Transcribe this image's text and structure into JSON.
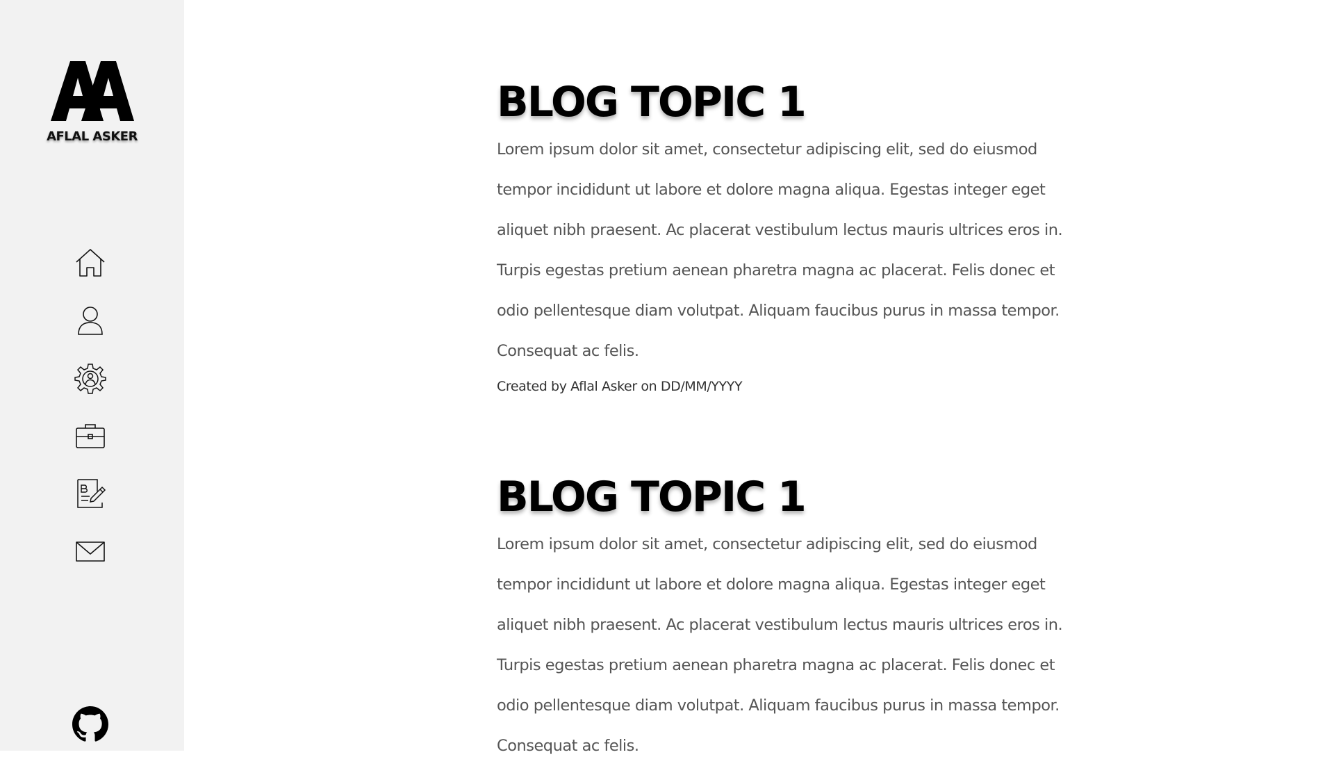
{
  "brand": {
    "name": "AFLAL ASKER"
  },
  "nav": [
    {
      "icon": "home-icon"
    },
    {
      "icon": "user-icon"
    },
    {
      "icon": "skills-gear-icon"
    },
    {
      "icon": "briefcase-icon"
    },
    {
      "icon": "blog-edit-icon"
    },
    {
      "icon": "mail-icon"
    }
  ],
  "footer": {
    "icon": "github-icon"
  },
  "posts": [
    {
      "title": "BLOG TOPIC 1",
      "lines": [
        "Lorem ipsum dolor sit amet, consectetur adipiscing elit, sed do eiusmod",
        " tempor incididunt ut labore et dolore magna aliqua. Egestas integer eget",
        " aliquet nibh praesent. Ac placerat vestibulum lectus mauris ultrices eros in.",
        "Turpis egestas pretium aenean pharetra magna ac placerat. Felis donec et",
        "odio pellentesque diam volutpat. Aliquam faucibus purus in massa tempor.",
        "Consequat ac felis."
      ],
      "meta": "Created by Aflal Asker on DD/MM/YYYY"
    },
    {
      "title": "BLOG TOPIC 1",
      "lines": [
        "Lorem ipsum dolor sit amet, consectetur adipiscing elit, sed do eiusmod",
        " tempor incididunt ut labore et dolore magna aliqua. Egestas integer eget",
        " aliquet nibh praesent. Ac placerat vestibulum lectus mauris ultrices eros in.",
        "Turpis egestas pretium aenean pharetra magna ac placerat. Felis donec et",
        "odio pellentesque diam volutpat. Aliquam faucibus purus in massa tempor.",
        "Consequat ac felis."
      ]
    }
  ],
  "colors": {
    "sidebar_bg": "#f2f2f2",
    "text_body": "#555555",
    "title": "#000000"
  }
}
